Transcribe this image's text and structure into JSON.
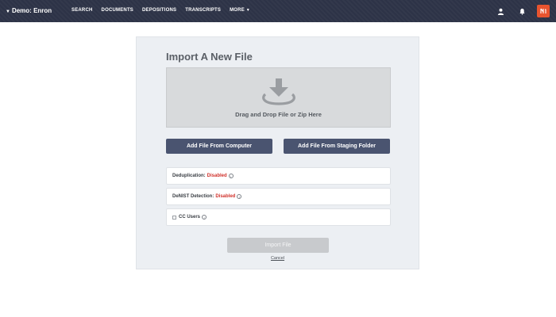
{
  "topbar": {
    "workspace_caret": "▼",
    "workspace": "Demo: Enron",
    "nav": {
      "search": "SEARCH",
      "documents": "DOCUMENTS",
      "depositions": "DEPOSITIONS",
      "transcripts": "TRANSCRIPTS",
      "more": "MORE",
      "more_caret": "▼"
    },
    "icons": [
      "user-icon",
      "bell-icon",
      "brand-logo-icon"
    ],
    "colors": {
      "background": "#2e3448",
      "brand_badge": "#e8542f"
    }
  },
  "import_panel": {
    "title": "Import A New File",
    "dropzone_text": "Drag and Drop File or Zip Here",
    "dropzone_icon": "download-tray-icon",
    "add_from_computer": "Add File From Computer",
    "add_from_staging": "Add File From Staging Folder",
    "options": {
      "dedup_label": "Deduplication:",
      "dedup_status": "Disabled",
      "denist_label": "DeNIST Detection:",
      "denist_status": "Disabled",
      "cc_users_label": "CC Users",
      "cc_users_checked": false
    },
    "import_button": "Import File",
    "cancel_link": "Cancel",
    "colors": {
      "primary_button": "#4a5470",
      "disabled_status": "#d0302a",
      "import_disabled": "#c8cacd"
    }
  }
}
